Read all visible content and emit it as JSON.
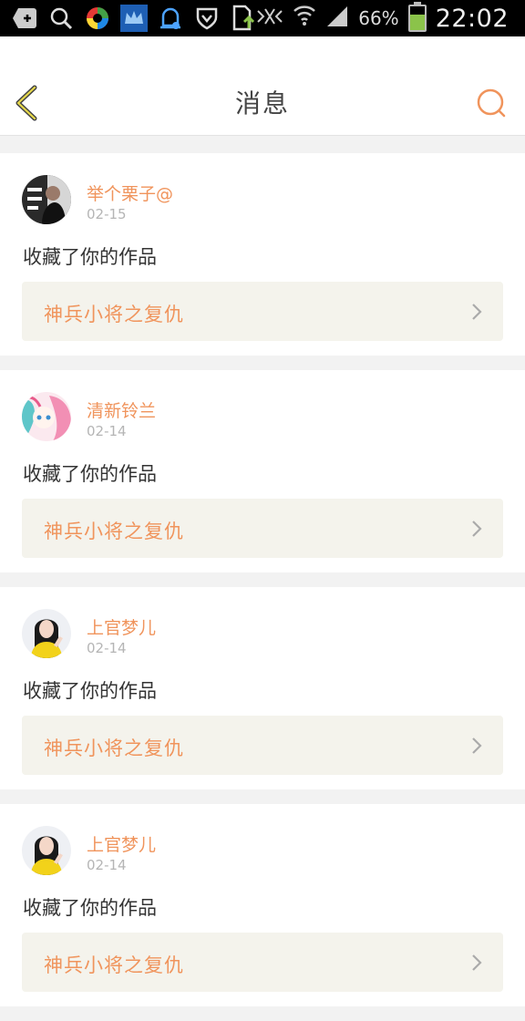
{
  "status_bar": {
    "battery_pct": "66%",
    "time": "22:02",
    "icons": [
      "add-box-icon",
      "search-icon",
      "colorful-app-icon",
      "crown-app-icon",
      "qq-icon",
      "shield-icon",
      "download-icon",
      "silent-icon",
      "wifi-icon",
      "signal-icon",
      "battery-icon"
    ]
  },
  "header": {
    "title": "消息",
    "back_icon": "chevron-left-icon",
    "search_icon": "search-icon"
  },
  "accent_color": "#f0945c",
  "messages": [
    {
      "username": "举个栗子@",
      "date": "02-15",
      "action": "收藏了你的作品",
      "work_title": "神兵小将之复仇"
    },
    {
      "username": "清新铃兰",
      "date": "02-14",
      "action": "收藏了你的作品",
      "work_title": "神兵小将之复仇"
    },
    {
      "username": "上官梦儿",
      "date": "02-14",
      "action": "收藏了你的作品",
      "work_title": "神兵小将之复仇"
    },
    {
      "username": "上官梦儿",
      "date": "02-14",
      "action": "收藏了你的作品",
      "work_title": "神兵小将之复仇"
    }
  ]
}
